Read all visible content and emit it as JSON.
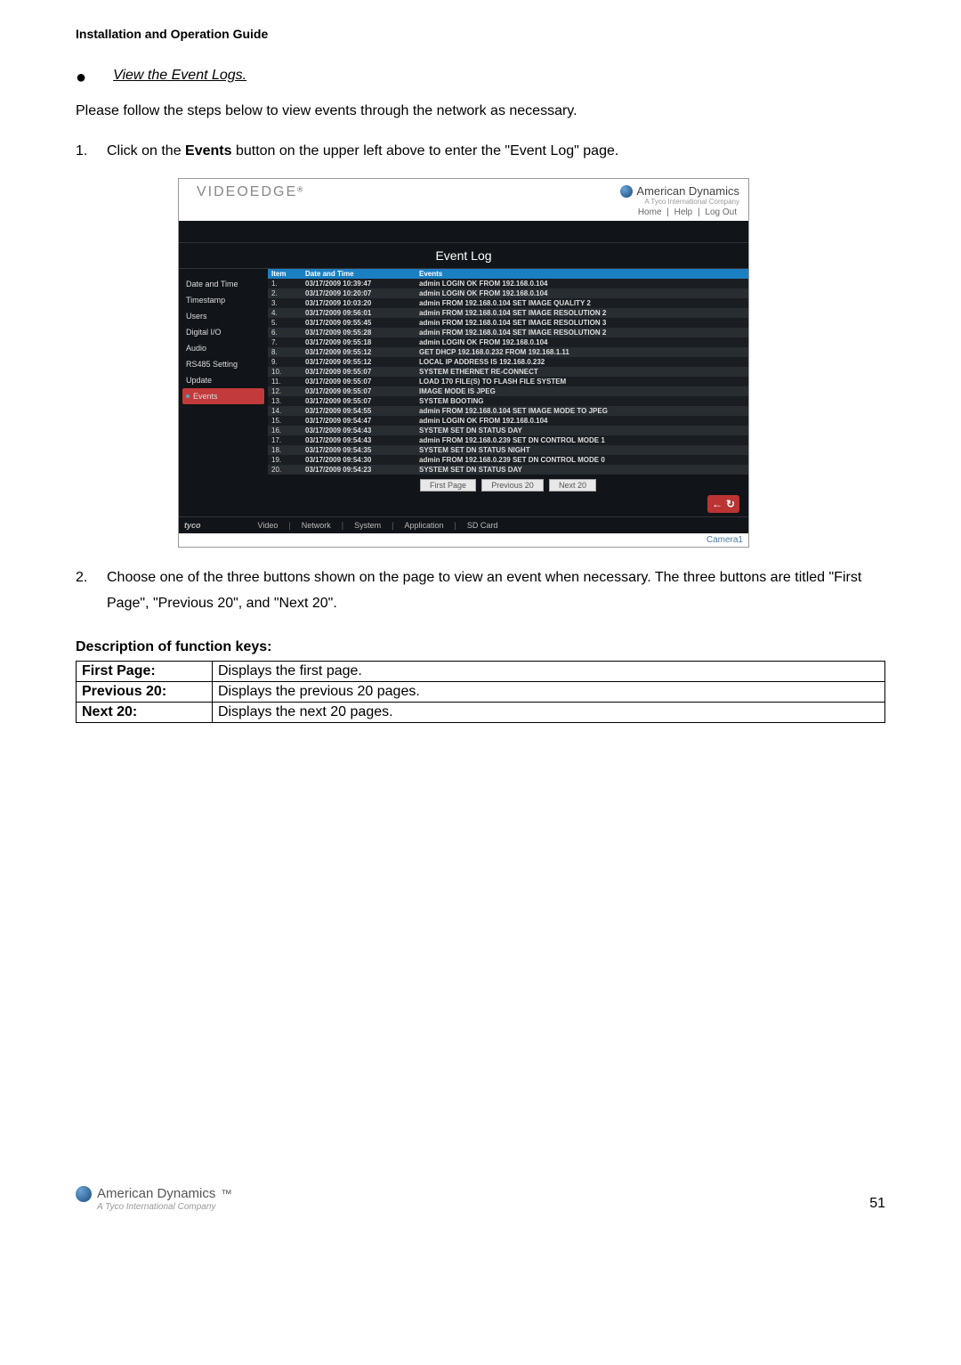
{
  "header": "Installation and Operation Guide",
  "bullet": {
    "glyph": "●",
    "text": "View the Event Logs."
  },
  "intro": "Please follow the steps below to view events through the network as necessary.",
  "step1": {
    "num": "1.",
    "pre": "Click on the ",
    "bold": "Events",
    "post": " button on the upper left above to enter the \"Event Log\" page."
  },
  "step2": {
    "num": "2.",
    "text": "Choose one of the three buttons shown on the page to view an event when necessary. The three buttons are titled \"First Page\", \"Previous 20\", and \"Next 20\"."
  },
  "screenshot": {
    "brandLeft": "VIDEOEDGE",
    "brandSup": "®",
    "brandRight": "American Dynamics",
    "brandRightSub": "A Tyco International Company",
    "links": [
      "Home",
      "Help",
      "Log Out"
    ],
    "title": "Event Log",
    "sidebar": [
      "Date and Time",
      "Timestamp",
      "Users",
      "Digital I/O",
      "Audio",
      "RS485 Setting",
      "Update",
      "Events"
    ],
    "columns": [
      "Item",
      "Date and Time",
      "Events"
    ],
    "rows": [
      {
        "i": "1.",
        "dt": "03/17/2009 10:39:47",
        "ev": "admin LOGIN OK FROM 192.168.0.104"
      },
      {
        "i": "2.",
        "dt": "03/17/2009 10:20:07",
        "ev": "admin LOGIN OK FROM 192.168.0.104"
      },
      {
        "i": "3.",
        "dt": "03/17/2009 10:03:20",
        "ev": "admin FROM 192.168.0.104 SET IMAGE QUALITY 2"
      },
      {
        "i": "4.",
        "dt": "03/17/2009 09:56:01",
        "ev": "admin FROM 192.168.0.104 SET IMAGE RESOLUTION 2"
      },
      {
        "i": "5.",
        "dt": "03/17/2009 09:55:45",
        "ev": "admin FROM 192.168.0.104 SET IMAGE RESOLUTION 3"
      },
      {
        "i": "6.",
        "dt": "03/17/2009 09:55:28",
        "ev": "admin FROM 192.168.0.104 SET IMAGE RESOLUTION 2"
      },
      {
        "i": "7.",
        "dt": "03/17/2009 09:55:18",
        "ev": "admin LOGIN OK FROM 192.168.0.104"
      },
      {
        "i": "8.",
        "dt": "03/17/2009 09:55:12",
        "ev": "GET DHCP 192.168.0.232 FROM 192.168.1.11"
      },
      {
        "i": "9.",
        "dt": "03/17/2009 09:55:12",
        "ev": "LOCAL IP ADDRESS IS 192.168.0.232"
      },
      {
        "i": "10.",
        "dt": "03/17/2009 09:55:07",
        "ev": "SYSTEM ETHERNET RE-CONNECT"
      },
      {
        "i": "11.",
        "dt": "03/17/2009 09:55:07",
        "ev": "LOAD 170 FILE(S) TO FLASH FILE SYSTEM"
      },
      {
        "i": "12.",
        "dt": "03/17/2009 09:55:07",
        "ev": "IMAGE MODE IS JPEG"
      },
      {
        "i": "13.",
        "dt": "03/17/2009 09:55:07",
        "ev": "SYSTEM BOOTING"
      },
      {
        "i": "14.",
        "dt": "03/17/2009 09:54:55",
        "ev": "admin FROM 192.168.0.104 SET IMAGE MODE TO JPEG"
      },
      {
        "i": "15.",
        "dt": "03/17/2009 09:54:47",
        "ev": "admin LOGIN OK FROM 192.168.0.104"
      },
      {
        "i": "16.",
        "dt": "03/17/2009 09:54:43",
        "ev": "SYSTEM SET DN STATUS DAY"
      },
      {
        "i": "17.",
        "dt": "03/17/2009 09:54:43",
        "ev": "admin FROM 192.168.0.239 SET DN CONTROL MODE 1"
      },
      {
        "i": "18.",
        "dt": "03/17/2009 09:54:35",
        "ev": "SYSTEM SET DN STATUS NIGHT"
      },
      {
        "i": "19.",
        "dt": "03/17/2009 09:54:30",
        "ev": "admin FROM 192.168.0.239 SET DN CONTROL MODE 0"
      },
      {
        "i": "20.",
        "dt": "03/17/2009 09:54:23",
        "ev": "SYSTEM SET DN STATUS DAY"
      }
    ],
    "buttons": [
      "First Page",
      "Previous 20",
      "Next 20"
    ],
    "navBack": "←",
    "navRefresh": "↻",
    "bottomBrand": "tyco",
    "bottomTabs": [
      "Video",
      "Network",
      "System",
      "Application",
      "SD Card"
    ],
    "footerText": "Camera1"
  },
  "fkHeading": "Description of function keys:",
  "fk": [
    {
      "k": "First Page:",
      "v": "Displays the first page."
    },
    {
      "k": "Previous 20:",
      "v": "Displays the previous 20 pages."
    },
    {
      "k": "Next 20:",
      "v": "Displays the next 20 pages."
    }
  ],
  "footer": {
    "brand": "American Dynamics",
    "tm": "™",
    "sub": "A Tyco International Company",
    "page": "51"
  }
}
